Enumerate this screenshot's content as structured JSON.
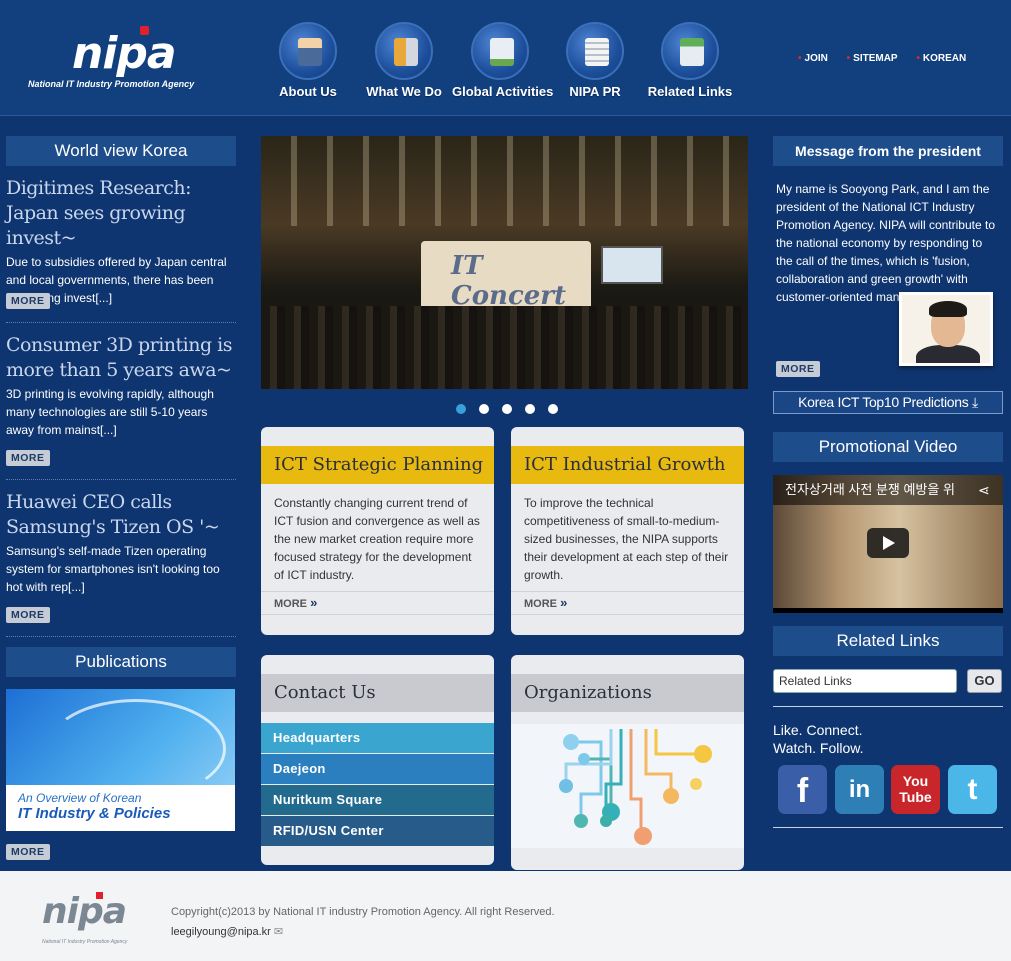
{
  "header": {
    "logo_text": "nipa",
    "logo_tagline": "National IT Industry Promotion Agency",
    "nav": [
      {
        "label": "About Us",
        "icon": "business-person-icon"
      },
      {
        "label": "What We Do",
        "icon": "binder-icon"
      },
      {
        "label": "Global Activities",
        "icon": "monitor-chart-icon"
      },
      {
        "label": "NIPA PR",
        "icon": "newspaper-icon"
      },
      {
        "label": "Related Links",
        "icon": "computer-icon"
      }
    ],
    "top_links": [
      "JOIN",
      "SITEMAP",
      "KOREAN"
    ]
  },
  "left": {
    "world_view_title": "World view Korea",
    "news": [
      {
        "title": "Digitimes Research: Japan sees growing invest~",
        "desc": "Due to subsidies offered by Japan central and local governments, there has been increasing invest[...]",
        "more": "MORE"
      },
      {
        "title": "Consumer 3D printing is more than 5 years awa~",
        "desc": "3D printing is evolving rapidly, although many technologies are still 5-10 years away from mainst[...]",
        "more": "MORE"
      },
      {
        "title": "Huawei CEO calls Samsung's Tizen OS '~",
        "desc": "Samsung's self-made Tizen operating system for smartphones isn't looking too hot with rep[...]",
        "more": "MORE"
      }
    ],
    "publications_title": "Publications",
    "publication_line1": "An Overview of Korean",
    "publication_line2": "IT Industry & Policies",
    "publication_more": "MORE"
  },
  "center": {
    "hero_stage_text": "IT Concert",
    "slides": 5,
    "active_slide": 1,
    "cards": [
      {
        "title": "ICT Strategic Planning",
        "body": "Constantly changing current trend of ICT fusion and convergence as well as the new market creation require more focused strategy for the development of ICT industry.",
        "more": "MORE"
      },
      {
        "title": "ICT Industrial Growth",
        "body": "To improve the technical competitiveness of small-to-medium-sized businesses, the NIPA supports their development at each step of their growth.",
        "more": "MORE"
      }
    ],
    "contact_title": "Contact Us",
    "contact_links": [
      "Headquarters",
      "Daejeon",
      "Nuritkum Square",
      "RFID/USN Center"
    ],
    "organizations_title": "Organizations"
  },
  "right": {
    "message_title": "Message from the president",
    "message_body": "My name is Sooyong Park, and I am the president of the National ICT Industry Promotion Agency. NIPA will contribute to the national economy by responding to the call of the times, which is 'fusion, collaboration and green growth' with customer-oriented management based...",
    "message_more": "MORE",
    "predictions_label": "Korea ICT Top10 Predictions",
    "video_title": "Promotional Video",
    "video_caption": "전자상거래 사전 분쟁 예방을 위",
    "related_title": "Related Links",
    "related_select": "Related Links",
    "go_label": "GO",
    "like_line1": "Like. Connect.",
    "like_line2": "Watch. Follow.",
    "social": [
      "f",
      "in",
      "You Tube",
      "t"
    ]
  },
  "footer": {
    "logo_text": "nipa",
    "logo_tagline": "National IT Industry Promotion Agency",
    "copyright": "Copyright(c)2013 by National IT industry Promotion Agency. All right Reserved.",
    "email": "leegilyoung@nipa.kr"
  },
  "colors": {
    "background": "#0e3570",
    "header": "#12407f",
    "card_yellow": "#e8b90e",
    "card_gray": "#c8cacf",
    "contact_link_1": "#3aa6cf",
    "contact_link_2": "#2c7fbf",
    "contact_link_3": "#226a8e",
    "contact_link_4": "#275b8a"
  }
}
